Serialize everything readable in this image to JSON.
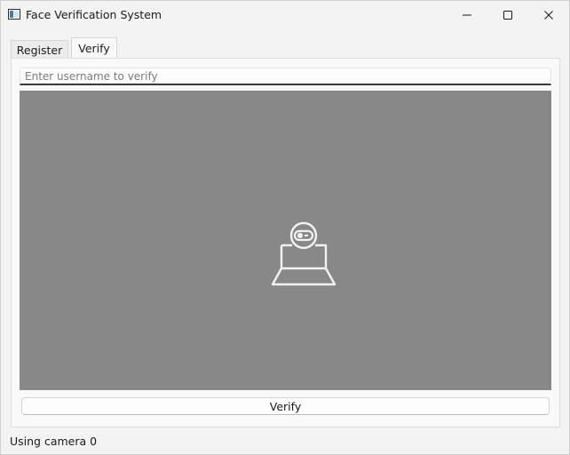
{
  "window": {
    "title": "Face Verification System",
    "icon": "app-window-icon"
  },
  "titlebar_controls": {
    "minimize_icon": "minimize-icon",
    "maximize_icon": "maximize-icon",
    "close_icon": "close-icon"
  },
  "tabs": [
    {
      "label": "Register",
      "selected": false
    },
    {
      "label": "Verify",
      "selected": true
    }
  ],
  "verify_tab": {
    "username_input": {
      "value": "",
      "placeholder": "Enter username to verify"
    },
    "camera_view": {
      "icon": "webcam-icon",
      "background": "#888888"
    },
    "verify_button_label": "Verify"
  },
  "status_bar": {
    "text": "Using camera 0"
  }
}
